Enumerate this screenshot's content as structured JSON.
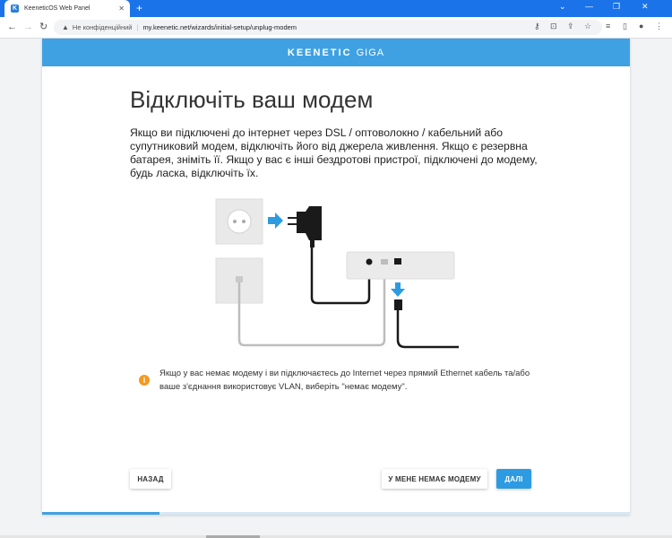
{
  "browser": {
    "tab_title": "KeeneticOS Web Panel",
    "url": "my.keenetic.net/wizards/initial-setup/unplug-modem",
    "security_text": "Не конфіденційний"
  },
  "header": {
    "brand_main": "KEENETIC",
    "brand_model": "GIGA",
    "color": "#3fa1e2"
  },
  "page": {
    "title": "Відключіть ваш модем",
    "intro": "Якщо ви підключені до інтернет через DSL / оптоволокно / кабельний або супутниковий модем, відключіть його від джерела живлення. Якщо є резервна батарея, зніміть її. Якщо у вас є інші бездротові пристрої, підключені до модему, будь ласка, відключіть їх.",
    "note": "Якщо у вас немає модему і ви підключаєтесь до Internet через прямий Ethernet кабель та/або ваше з'єднання використовує VLAN, виберіть \"немає модему\".",
    "note_icon_glyph": "i"
  },
  "buttons": {
    "back": "НАЗАД",
    "no_modem": "У МЕНЕ НЕМАЄ МОДЕМУ",
    "next": "ДАЛІ"
  },
  "wizard_progress": 0.2,
  "icons": [
    "warning-icon",
    "info-icon",
    "arrow-right-icon",
    "arrow-down-icon",
    "power-adapter-icon",
    "socket-icon",
    "router-icon"
  ]
}
